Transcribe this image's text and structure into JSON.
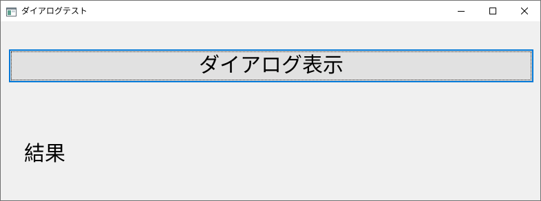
{
  "window": {
    "title": "ダイアログテスト",
    "app_icon": "window-app-icon",
    "controls": {
      "minimize_icon": "minimize-icon",
      "maximize_icon": "maximize-icon",
      "close_icon": "close-icon"
    }
  },
  "main": {
    "dialog_button_label": "ダイアログ表示",
    "result_label": "結果"
  },
  "colors": {
    "focus_border": "#0078d7",
    "button_face": "#e1e1e1",
    "client_background": "#f0f0f0",
    "titlebar_background": "#ffffff"
  }
}
